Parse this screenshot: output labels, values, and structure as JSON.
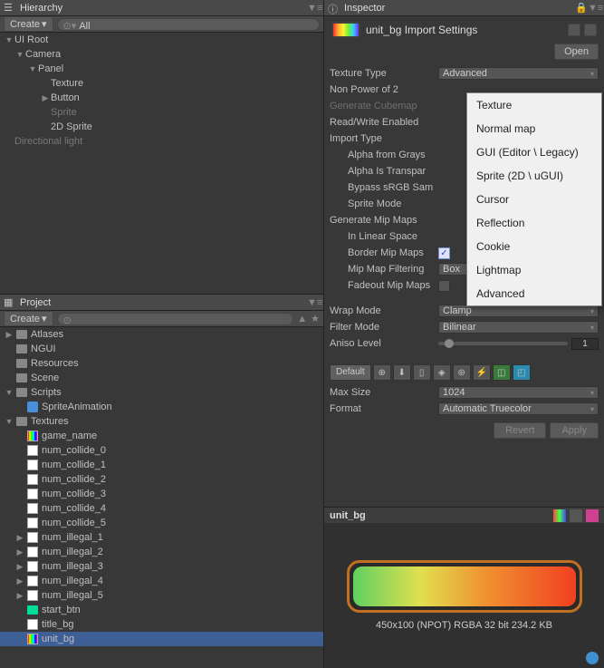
{
  "hierarchy": {
    "title": "Hierarchy",
    "create_label": "Create",
    "search_prefix": "All",
    "items": [
      {
        "label": "UI Root",
        "indent": 0,
        "arrow": "expanded"
      },
      {
        "label": "Camera",
        "indent": 1,
        "arrow": "expanded"
      },
      {
        "label": "Panel",
        "indent": 2,
        "arrow": "expanded"
      },
      {
        "label": "Texture",
        "indent": 3,
        "arrow": "none"
      },
      {
        "label": "Button",
        "indent": 3,
        "arrow": "collapsed"
      },
      {
        "label": "Sprite",
        "indent": 3,
        "arrow": "none",
        "dim": true
      },
      {
        "label": "2D Sprite",
        "indent": 3,
        "arrow": "none"
      },
      {
        "label": "Directional light",
        "indent": 0,
        "arrow": "none",
        "dim": true
      }
    ]
  },
  "project": {
    "title": "Project",
    "create_label": "Create",
    "items": [
      {
        "label": "Atlases",
        "indent": 0,
        "arrow": "collapsed",
        "icon": "folder"
      },
      {
        "label": "NGUI",
        "indent": 0,
        "arrow": "none",
        "icon": "folder"
      },
      {
        "label": "Resources",
        "indent": 0,
        "arrow": "none",
        "icon": "folder"
      },
      {
        "label": "Scene",
        "indent": 0,
        "arrow": "none",
        "icon": "folder"
      },
      {
        "label": "Scripts",
        "indent": 0,
        "arrow": "expanded",
        "icon": "folder"
      },
      {
        "label": "SpriteAnimation",
        "indent": 1,
        "arrow": "none",
        "icon": "cs"
      },
      {
        "label": "Textures",
        "indent": 0,
        "arrow": "expanded",
        "icon": "folder"
      },
      {
        "label": "game_name",
        "indent": 1,
        "arrow": "none",
        "icon": "rainbow"
      },
      {
        "label": "num_collide_0",
        "indent": 1,
        "arrow": "none",
        "icon": "tex"
      },
      {
        "label": "num_collide_1",
        "indent": 1,
        "arrow": "none",
        "icon": "tex"
      },
      {
        "label": "num_collide_2",
        "indent": 1,
        "arrow": "none",
        "icon": "tex"
      },
      {
        "label": "num_collide_3",
        "indent": 1,
        "arrow": "none",
        "icon": "tex"
      },
      {
        "label": "num_collide_4",
        "indent": 1,
        "arrow": "none",
        "icon": "tex"
      },
      {
        "label": "num_collide_5",
        "indent": 1,
        "arrow": "none",
        "icon": "tex"
      },
      {
        "label": "num_illegal_1",
        "indent": 1,
        "arrow": "collapsed",
        "icon": "tex"
      },
      {
        "label": "num_illegal_2",
        "indent": 1,
        "arrow": "collapsed",
        "icon": "tex"
      },
      {
        "label": "num_illegal_3",
        "indent": 1,
        "arrow": "collapsed",
        "icon": "tex"
      },
      {
        "label": "num_illegal_4",
        "indent": 1,
        "arrow": "collapsed",
        "icon": "tex"
      },
      {
        "label": "num_illegal_5",
        "indent": 1,
        "arrow": "collapsed",
        "icon": "tex"
      },
      {
        "label": "start_btn",
        "indent": 1,
        "arrow": "none",
        "icon": "clip"
      },
      {
        "label": "title_bg",
        "indent": 1,
        "arrow": "none",
        "icon": "tex"
      },
      {
        "label": "unit_bg",
        "indent": 1,
        "arrow": "none",
        "icon": "rainbow",
        "selected": true
      }
    ]
  },
  "inspector": {
    "title": "Inspector",
    "asset_title": "unit_bg Import Settings",
    "open_label": "Open",
    "props": {
      "texture_type": {
        "label": "Texture Type",
        "value": "Advanced"
      },
      "non_power_2": {
        "label": "Non Power of 2"
      },
      "gen_cubemap": {
        "label": "Generate Cubemap"
      },
      "read_write": {
        "label": "Read/Write Enabled"
      },
      "import_type": {
        "label": "Import Type"
      },
      "alpha_gray": {
        "label": "Alpha from Grays"
      },
      "alpha_trans": {
        "label": "Alpha Is Transpar"
      },
      "bypass_srgb": {
        "label": "Bypass sRGB Sam"
      },
      "sprite_mode": {
        "label": "Sprite Mode"
      },
      "gen_mipmaps": {
        "label": "Generate Mip Maps"
      },
      "linear_space": {
        "label": "In Linear Space"
      },
      "border_mip": {
        "label": "Border Mip Maps"
      },
      "mip_filter": {
        "label": "Mip Map Filtering",
        "value": "Box"
      },
      "fadeout_mip": {
        "label": "Fadeout Mip Maps"
      },
      "wrap_mode": {
        "label": "Wrap Mode",
        "value": "Clamp"
      },
      "filter_mode": {
        "label": "Filter Mode",
        "value": "Bilinear"
      },
      "aniso": {
        "label": "Aniso Level",
        "value": "1"
      },
      "max_size": {
        "label": "Max Size",
        "value": "1024"
      },
      "format": {
        "label": "Format",
        "value": "Automatic Truecolor"
      }
    },
    "platforms": {
      "default": "Default"
    },
    "revert_label": "Revert",
    "apply_label": "Apply",
    "preview": {
      "title": "unit_bg",
      "meta": "450x100 (NPOT)   RGBA 32 bit   234.2 KB"
    },
    "dropdown_options": [
      "Texture",
      "Normal map",
      "GUI (Editor \\ Legacy)",
      "Sprite (2D \\ uGUI)",
      "Cursor",
      "Reflection",
      "Cookie",
      "Lightmap",
      "Advanced"
    ]
  }
}
